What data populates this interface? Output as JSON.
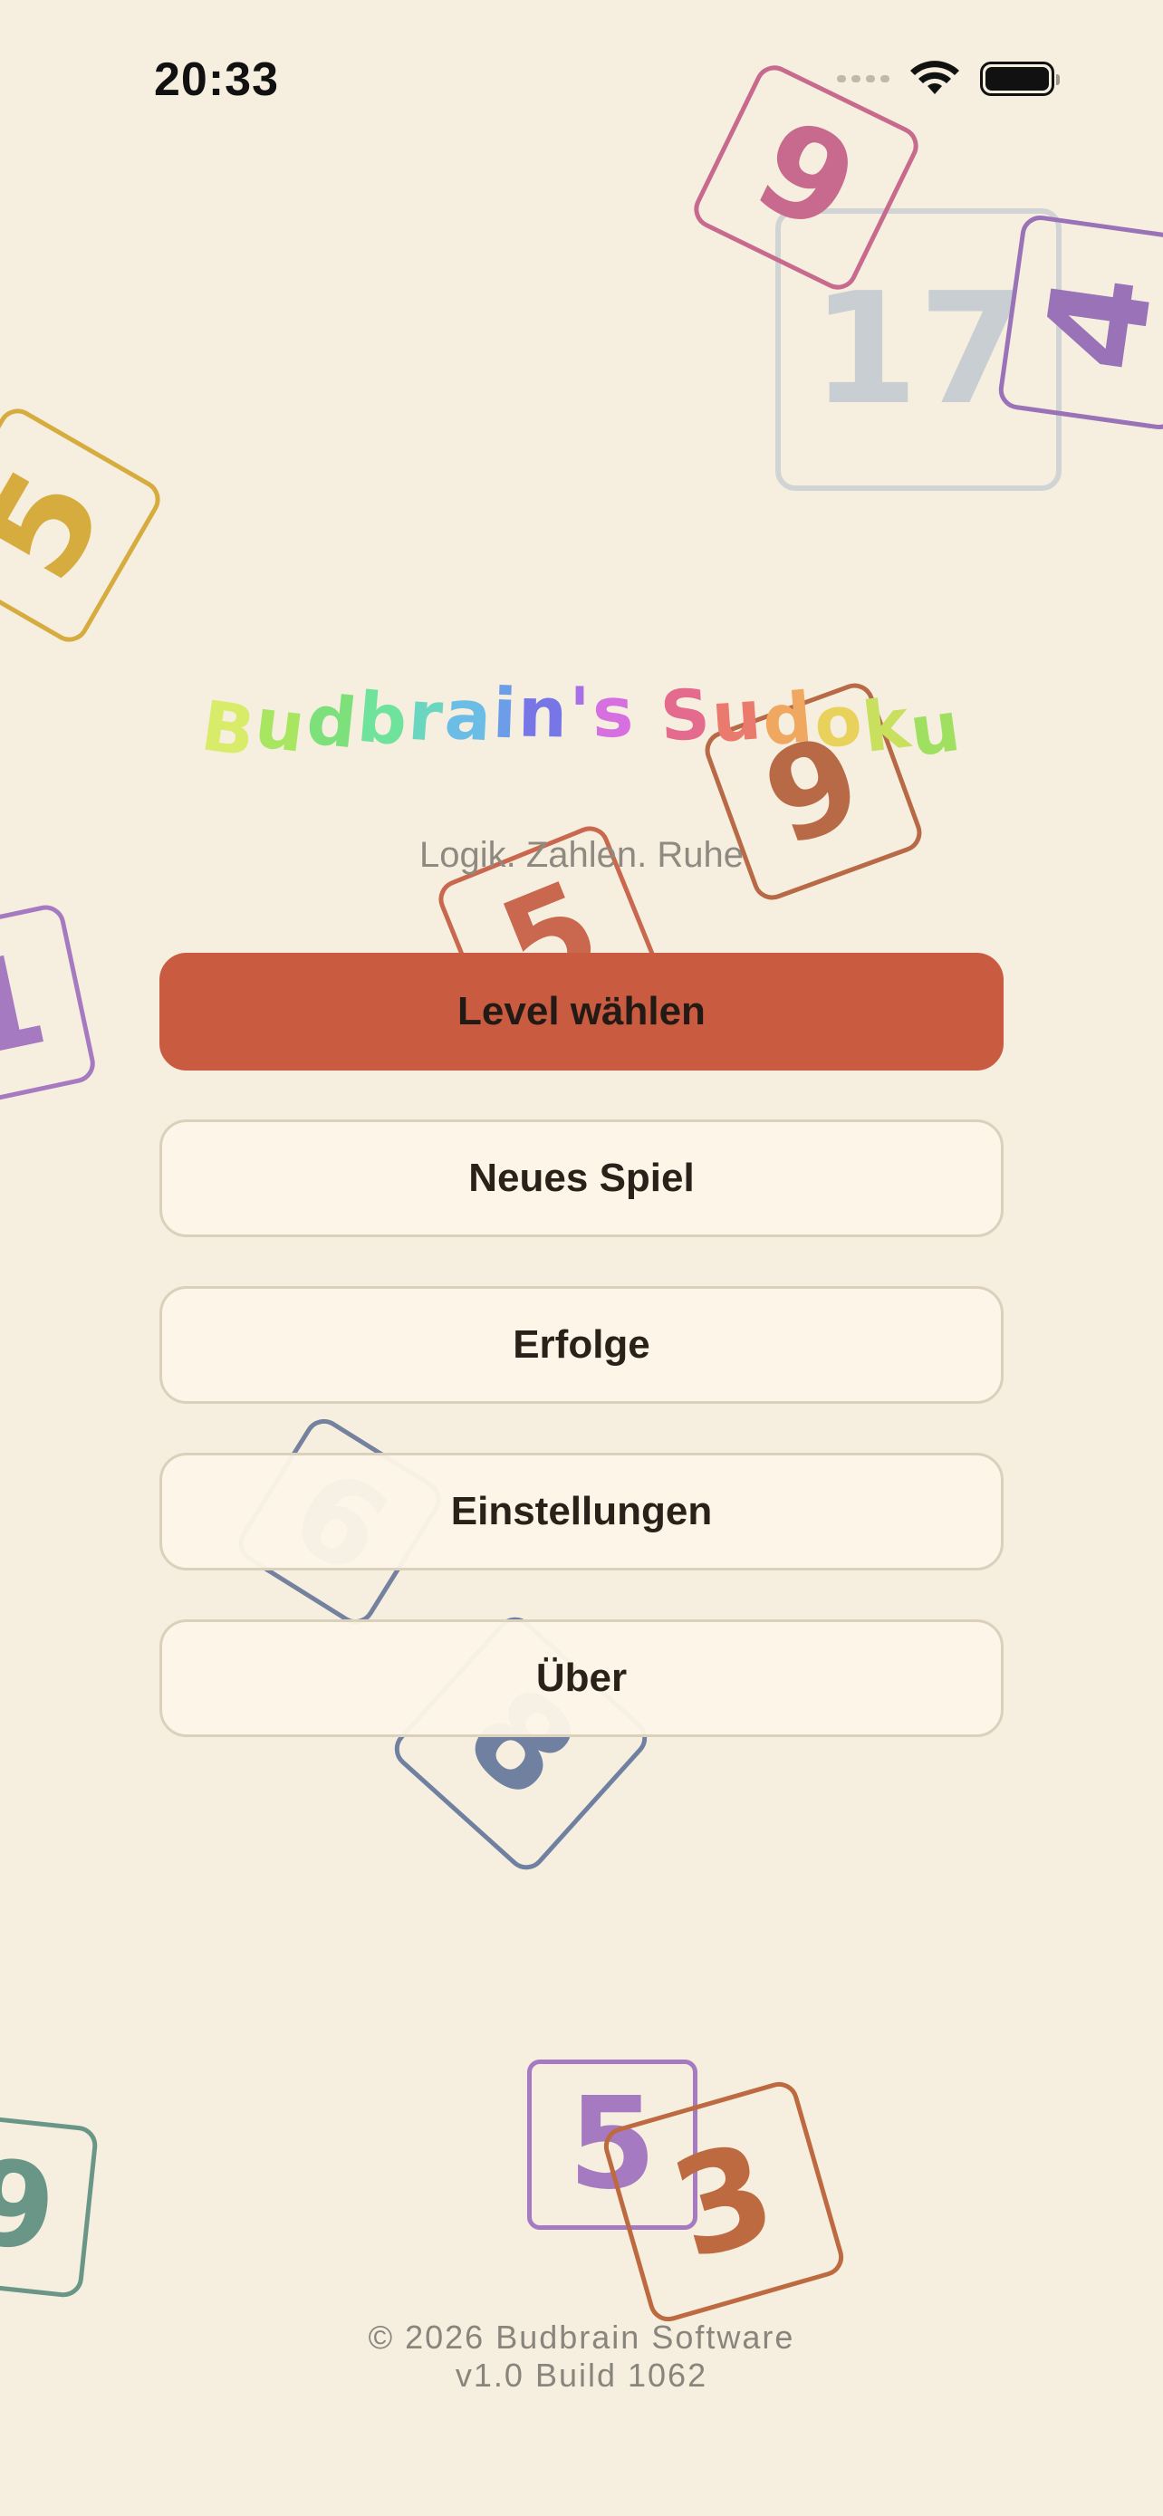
{
  "status_bar": {
    "time": "20:33",
    "icons": [
      "signal-icon",
      "wifi-icon",
      "battery-icon"
    ]
  },
  "app": {
    "title_letters": [
      {
        "ch": "B",
        "color": "#d9ec6a"
      },
      {
        "ch": "u",
        "color": "#a8e560"
      },
      {
        "ch": "d",
        "color": "#7de07a"
      },
      {
        "ch": "b",
        "color": "#6fe39c"
      },
      {
        "ch": "r",
        "color": "#6ad6c0"
      },
      {
        "ch": "a",
        "color": "#6cbde6"
      },
      {
        "ch": "i",
        "color": "#6b9de8"
      },
      {
        "ch": "n",
        "color": "#7676e6"
      },
      {
        "ch": "'",
        "color": "#a870e6"
      },
      {
        "ch": "s",
        "color": "#d66fe0"
      },
      {
        "ch": " ",
        "color": "#ffffff"
      },
      {
        "ch": "S",
        "color": "#e46a8e"
      },
      {
        "ch": "u",
        "color": "#ea7a6e"
      },
      {
        "ch": "d",
        "color": "#f0a860"
      },
      {
        "ch": "o",
        "color": "#e8d25c"
      },
      {
        "ch": "k",
        "color": "#c8e05e"
      },
      {
        "ch": "u",
        "color": "#a0e060"
      }
    ],
    "subtitle": "Logik. Zahlen. Ruhe"
  },
  "menu": {
    "level": "Level wählen",
    "new_game": "Neues Spiel",
    "achievements": "Erfolge",
    "settings": "Einstellungen",
    "about": "Über"
  },
  "footer": {
    "copyright": "© 2026 Budbrain Software",
    "version": "v1.0 Build 1062"
  },
  "decorative_tiles": [
    {
      "name": "tile-9-top",
      "digit": "9",
      "color": "#c86a8e"
    },
    {
      "name": "tile-17-top",
      "digit": "17",
      "color": "#c9ced3"
    },
    {
      "name": "tile-4-top",
      "digit": "4",
      "color": "#9a72b8"
    },
    {
      "name": "tile-5-left",
      "digit": "5",
      "color": "#d6ac3e"
    },
    {
      "name": "tile-9-title",
      "digit": "9",
      "color": "#b86a46"
    },
    {
      "name": "tile-5-subtitle",
      "digit": "5",
      "color": "#c9684f"
    },
    {
      "name": "tile-1-left",
      "digit": "1",
      "color": "#a57ac0"
    },
    {
      "name": "tile-6-mid",
      "digit": "6",
      "color": "#74829f"
    },
    {
      "name": "tile-8-mid",
      "digit": "8",
      "color": "#7080a0"
    },
    {
      "name": "tile-9-bottom-left",
      "digit": "9",
      "color": "#6a9688"
    },
    {
      "name": "tile-5-bottom",
      "digit": "5",
      "color": "#a57ac0"
    },
    {
      "name": "tile-3-bottom",
      "digit": "3",
      "color": "#bd6a40"
    }
  ]
}
